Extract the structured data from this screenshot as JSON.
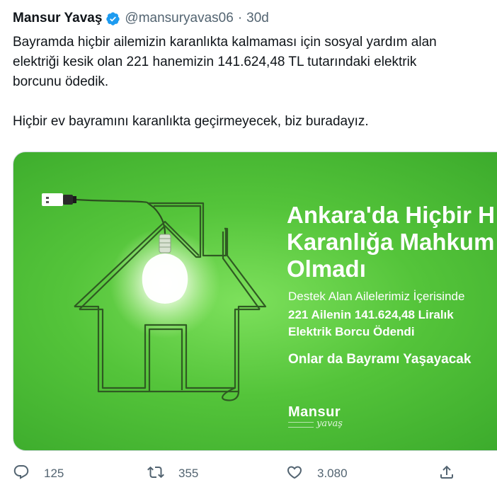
{
  "tweet": {
    "display_name": "Mansur Yavaş",
    "handle": "@mansuryavas06",
    "separator": "·",
    "time": "30d",
    "body": {
      "line1": "Bayramda hiçbir ailemizin karanlıkta kalmaması için sosyal yardım alan",
      "line2": "elektriği kesik olan 221 hanemizin 141.624,48 TL tutarındaki elektrik",
      "line3": "borcunu ödedik.",
      "line4": "Hiçbir ev bayramını karanlıkta geçirmeyecek, biz buradayız."
    }
  },
  "media": {
    "headline": [
      "Ankara'da Hiçbir H",
      "Karanlığa Mahkum",
      "Olmadı"
    ],
    "subtitle": "Destek Alan Ailelerimiz İçerisinde",
    "detail": [
      "221 Ailenin 141.624,48 Liralık",
      "Elektrik Borcu Ödendi"
    ],
    "closing": "Onlar da Bayramı Yaşayacak",
    "logo_main": "Mansur",
    "logo_sub": "yavaş",
    "background_color": "#54c43a"
  },
  "actions": {
    "reply": {
      "icon": "reply-icon",
      "count": "125"
    },
    "retweet": {
      "icon": "retweet-icon",
      "count": "355"
    },
    "like": {
      "icon": "heart-icon",
      "count": "3.080"
    },
    "share": {
      "icon": "share-icon"
    }
  },
  "colors": {
    "text": "#0f1419",
    "muted": "#536471",
    "verified": "#1d9bf0"
  }
}
